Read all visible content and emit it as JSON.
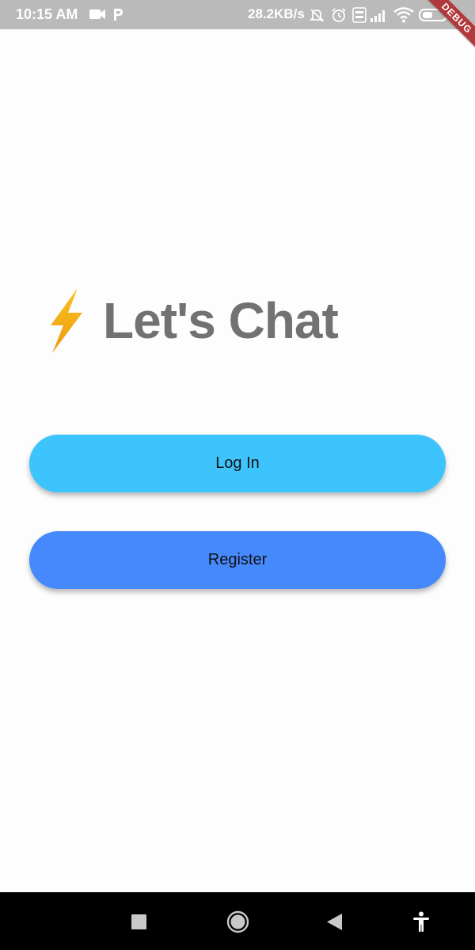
{
  "status_bar": {
    "time": "10:15 AM",
    "network_speed": "28.2KB/s",
    "icons": [
      "video-camera-icon",
      "p-icon",
      "alarm-off-icon",
      "alarm-icon",
      "volte-icon",
      "signal-icon",
      "wifi-icon",
      "battery-icon",
      "charging-icon"
    ]
  },
  "debug_banner": {
    "label": "DEBUG"
  },
  "header": {
    "icon": "lightning-bolt-icon",
    "title": "Let's Chat"
  },
  "buttons": {
    "login_label": "Log In",
    "register_label": "Register"
  },
  "nav_bar": {
    "icons": [
      "recents-square-icon",
      "home-circle-icon",
      "back-triangle-icon",
      "accessibility-icon"
    ]
  },
  "colors": {
    "login_button": "#3ec4fd",
    "register_button": "#4589fd",
    "title_text": "#717271",
    "bolt": "#f6b21a",
    "status_bar": "#b9bab9",
    "debug_banner": "#b2393b"
  }
}
